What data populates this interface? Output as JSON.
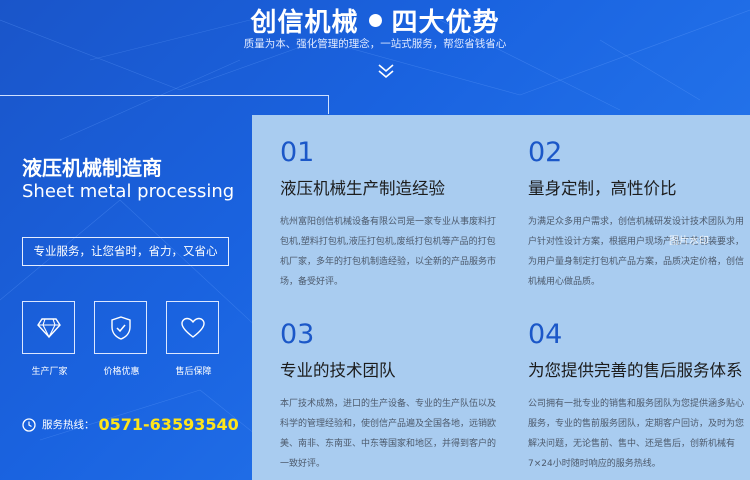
{
  "header": {
    "title_left": "创信机械",
    "title_right": "四大优势",
    "subtitle": "质量为本、强化管理的理念，一站式服务，帮您省钱省心"
  },
  "left_panel": {
    "title_cn": "液压机械制造商",
    "title_en": "Sheet metal processing",
    "tagline": "专业服务，让您省时，省力，又省心",
    "features": [
      {
        "icon": "diamond-icon",
        "label": "生产厂家"
      },
      {
        "icon": "shield-check-icon",
        "label": "价格优惠"
      },
      {
        "icon": "heart-icon",
        "label": "售后保障"
      }
    ],
    "hotline_label": "服务热线：",
    "hotline_number": "0571-63593540",
    "phone_color": "#ffe51a"
  },
  "advantages": [
    {
      "num": "01",
      "title": "液压机械生产制造经验",
      "desc": "杭州富阳创信机械设备有限公司是一家专业从事废料打包机,塑料打包机,液压打包机,废纸打包机等产品的打包机厂家，多年的打包机制造经验，以全新的产品服务市场，备受好评。"
    },
    {
      "num": "02",
      "title": "量身定制，高性价比",
      "desc": "为满足众多用户需求，创信机械研发设计技术团队为用户针对性设计方案，根据用户现场产品工艺包装要求，为用户量身制定打包机产品方案，品质决定价格，创信机械用心做品质。"
    },
    {
      "num": "03",
      "title": "专业的技术团队",
      "desc": "本厂技术成熟，进口的生产设备、专业的生产队伍以及科学的管理经验和，使创信产品遍及全国各地，远销欧美、南非、东南亚、中东等国家和地区，并得到客户的一致好评。"
    },
    {
      "num": "04",
      "title": "为您提供完善的售后服务体系",
      "desc": "公司拥有一批专业的销售和服务团队为您提供涵多贴心服务，专业的售前服务团队，定期客户回访，及时为您解决问题，无论售前、售中、还是售后，创新机械有7×24小时随时响应的服务热线。"
    }
  ],
  "watermark": "图片水印",
  "colors": {
    "accent_blue": "#1b57c8",
    "panel_bg": "#a9ccf0",
    "bg_blue": "#1a63e0"
  }
}
